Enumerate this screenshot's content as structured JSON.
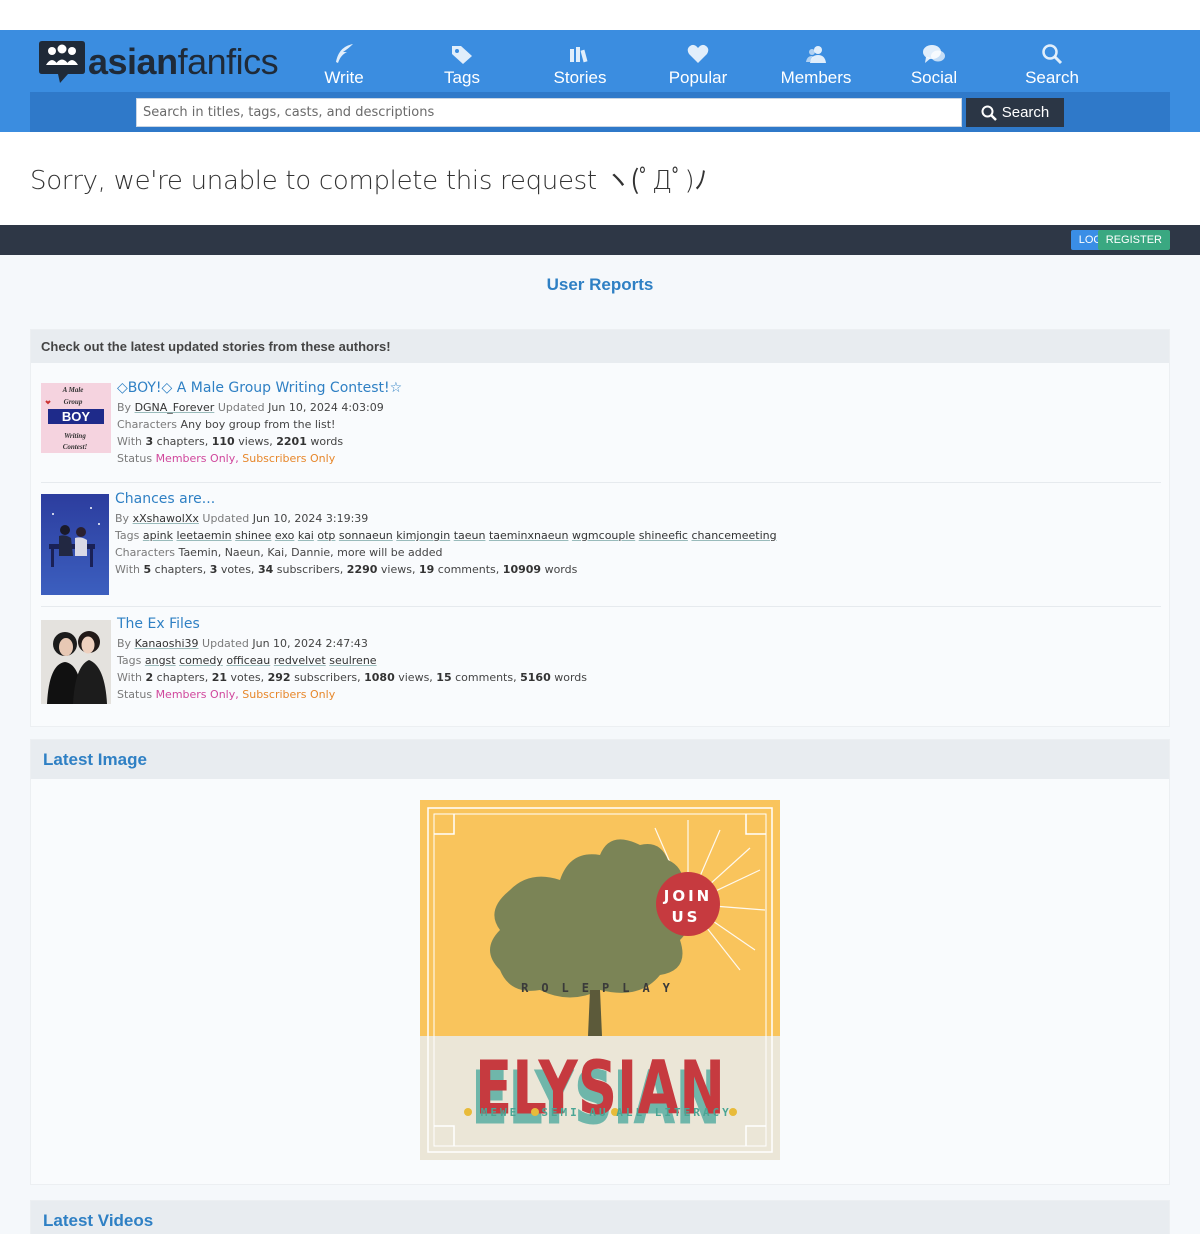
{
  "header": {
    "logo": {
      "bold": "asian",
      "light": "fanfics"
    },
    "nav": [
      {
        "label": "Write",
        "icon": "quill-icon"
      },
      {
        "label": "Tags",
        "icon": "tag-icon"
      },
      {
        "label": "Stories",
        "icon": "books-icon"
      },
      {
        "label": "Popular",
        "icon": "heart-icon"
      },
      {
        "label": "Members",
        "icon": "users-icon"
      },
      {
        "label": "Social",
        "icon": "chat-icon"
      },
      {
        "label": "Search",
        "icon": "search-icon"
      }
    ],
    "search": {
      "placeholder": "Search in titles, tags, casts, and descriptions",
      "button": "Search"
    }
  },
  "error_message": "Sorry, we're unable to complete this request ヽ(ﾟДﾟ)ﾉ",
  "auth": {
    "login": "LOG IN",
    "register": "REGISTER"
  },
  "user_reports": "User Reports",
  "latest_stories": {
    "heading": "Check out the latest updated stories from these authors!",
    "stories": [
      {
        "title": "◇BOY!◇ A Male Group Writing Contest!☆",
        "author": "DGNA_Forever",
        "updated": "Jun 10, 2024 4:03:09",
        "characters": "Any boy group from the list!",
        "chapters": "3",
        "views": "110",
        "words": "2201",
        "status": [
          "Members Only",
          "Subscribers Only"
        ],
        "thumb_text": [
          "A Male",
          "Group",
          "BOY",
          "Writing",
          "Contest!"
        ]
      },
      {
        "title": "Chances are...",
        "author": "xXshawolXx",
        "updated": "Jun 10, 2024 3:19:39",
        "tags": [
          "apink",
          "leetaemin",
          "shinee",
          "exo",
          "kai",
          "otp",
          "sonnaeun",
          "kimjongin",
          "taeun",
          "taeminxnaeun",
          "wgmcouple",
          "shineefic",
          "chancemeeting"
        ],
        "characters": "Taemin, Naeun, Kai, Dannie, more will be added",
        "chapters": "5",
        "votes": "3",
        "subscribers": "34",
        "views": "2290",
        "comments": "19",
        "words": "10909"
      },
      {
        "title": "The Ex Files",
        "author": "Kanaoshi39",
        "updated": "Jun 10, 2024 2:47:43",
        "tags": [
          "angst",
          "comedy",
          "officeau",
          "redvelvet",
          "seulrene"
        ],
        "chapters": "2",
        "votes": "21",
        "subscribers": "292",
        "views": "1080",
        "comments": "15",
        "words": "5160",
        "status": [
          "Members Only",
          "Subscribers Only"
        ]
      }
    ]
  },
  "labels": {
    "by": "By",
    "updated": "Updated",
    "characters": "Characters",
    "tags": "Tags",
    "with": "With",
    "status": "Status",
    "chapters": "chapters,",
    "votes": "votes,",
    "subscribers": "subscribers,",
    "views": "views,",
    "comments": "comments,",
    "words": "words",
    "views_last": "views,"
  },
  "latest_image": {
    "heading": "Latest Image",
    "poster": {
      "top": "JOIN",
      "top2": "US",
      "sub": "ROLEPLAY",
      "title": "ELYSIAN",
      "footer": [
        "MEWE",
        "SEMI AU",
        "ALL LITERACY"
      ]
    }
  },
  "latest_videos": {
    "heading": "Latest Videos"
  },
  "colors": {
    "header_blue": "#3b8de0",
    "dark_bar": "#2e3746",
    "link": "#2f80c4",
    "members_only": "#d0479c",
    "subscribers_only": "#e7872b"
  }
}
